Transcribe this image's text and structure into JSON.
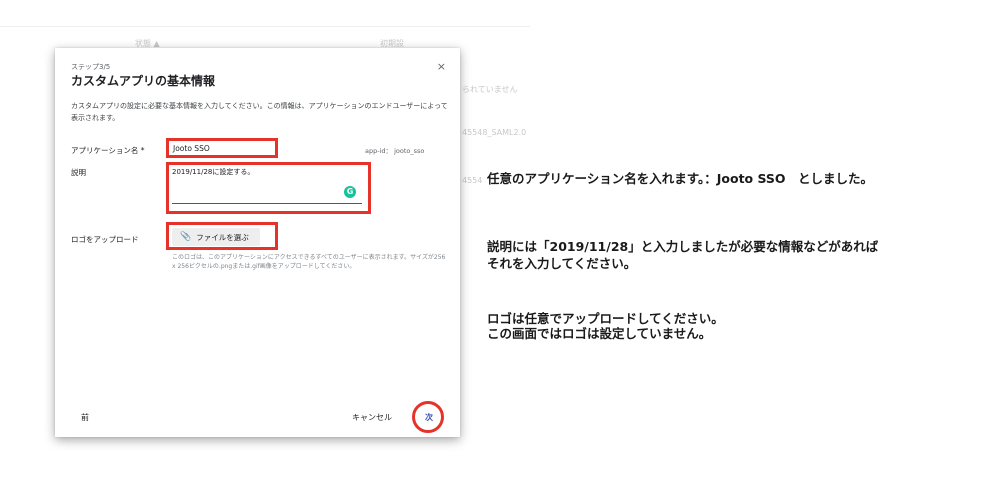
{
  "background": {
    "col_status": "状態 ▲",
    "col_access": "初期設",
    "row1": "られていません",
    "row2": "45548_SAML2.0",
    "row3": "4554"
  },
  "dialog": {
    "step": "ステップ3/5",
    "title": "カスタムアプリの基本情報",
    "close_icon": "×",
    "intro": "カスタムアプリの設定に必要な基本情報を入力してください。この情報は、アプリケーションのエンドユーザーによって表示されます。",
    "app_name_label": "アプリケーション名 *",
    "app_name_value": "Jooto SSO",
    "app_id": "app-id： jooto_sso",
    "description_label": "説明",
    "description_value": "2019/11/28に設定する。",
    "grammarly_icon": "G",
    "logo_label": "ロゴをアップロード",
    "file_button": "ファイルを選ぶ",
    "paperclip_icon": "📎",
    "logo_help": "このロゴは、このアプリケーションにアクセスできるすべてのユーザーに表示されます。サイズが256 x 256ピクセルの.pngまたは.gif画像をアップロードしてください。",
    "prev_button": "前",
    "cancel_button": "キャンセル",
    "next_button": "次"
  },
  "annotations": {
    "note1": "任意のアプリケーション名を入れます。：Jooto SSO　としました。",
    "note2_line1": "説明には「2019/11/28」と入力しましたが必要な情報などがあれば",
    "note2_line2": "それを入力してください。",
    "note3_line1": "ロゴは任意でアップロードしてください。",
    "note3_line2": "この画面ではロゴは設定していません。"
  },
  "colors": {
    "highlight_red": "#e5332a",
    "accent_blue": "#3d52b5",
    "grammarly_green": "#15c39a"
  }
}
